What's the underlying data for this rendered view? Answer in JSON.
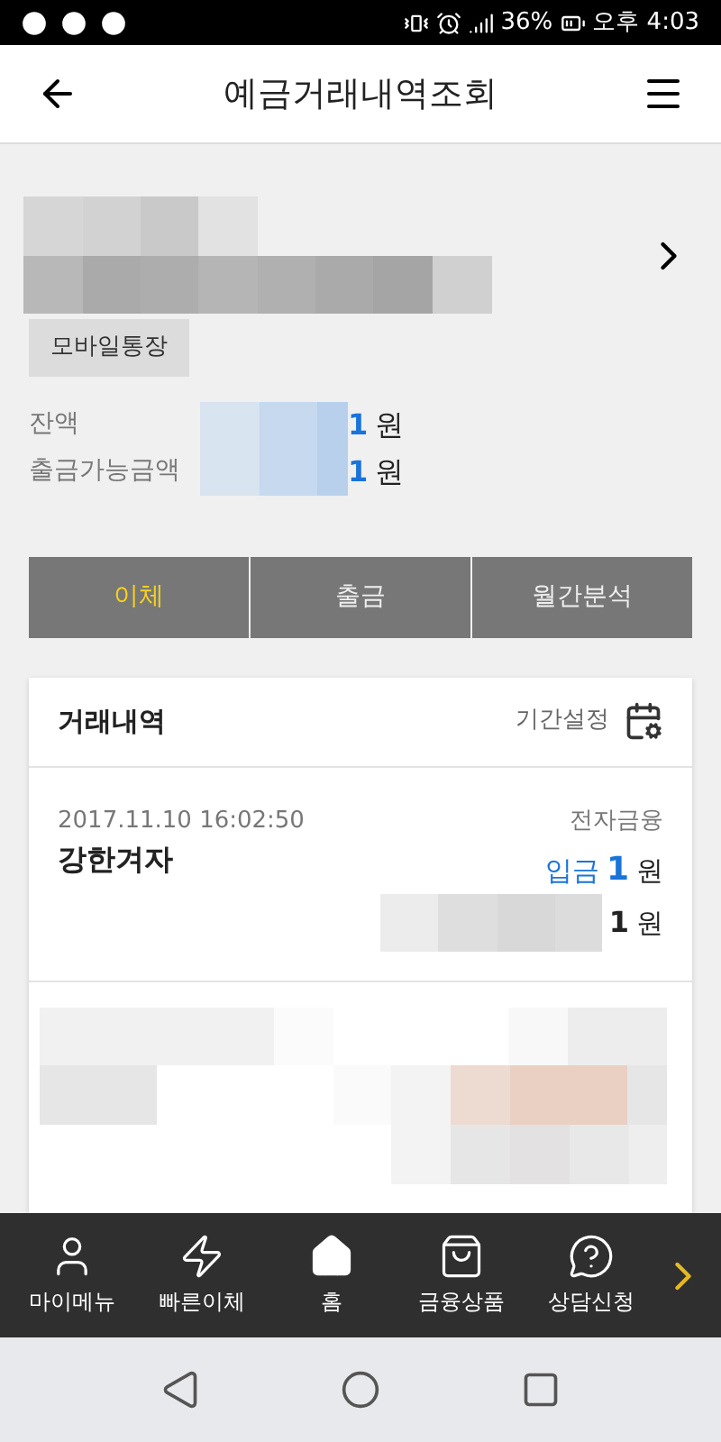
{
  "status_bar": {
    "battery": "36%",
    "time": "오후 4:03"
  },
  "header": {
    "title": "예금거래내역조회"
  },
  "account": {
    "badge": "모바일통장",
    "balances": [
      {
        "label": "잔액",
        "amount": "1",
        "unit": "원"
      },
      {
        "label": "출금가능금액",
        "amount": "1",
        "unit": "원"
      }
    ]
  },
  "actions": [
    {
      "label": "이체",
      "selected": true
    },
    {
      "label": "출금",
      "selected": false
    },
    {
      "label": "월간분석",
      "selected": false
    }
  ],
  "history": {
    "title": "거래내역",
    "period_label": "기간설정",
    "transactions": [
      {
        "datetime": "2017.11.10 16:02:50",
        "name": "강한겨자",
        "channel": "전자금융",
        "type": "입금",
        "amount": "1",
        "unit": "원",
        "balance": "1",
        "balance_unit": "원"
      }
    ]
  },
  "bottom_nav": [
    {
      "label": "마이메뉴"
    },
    {
      "label": "빠른이체"
    },
    {
      "label": "홈"
    },
    {
      "label": "금융상품"
    },
    {
      "label": "상담신청"
    }
  ]
}
